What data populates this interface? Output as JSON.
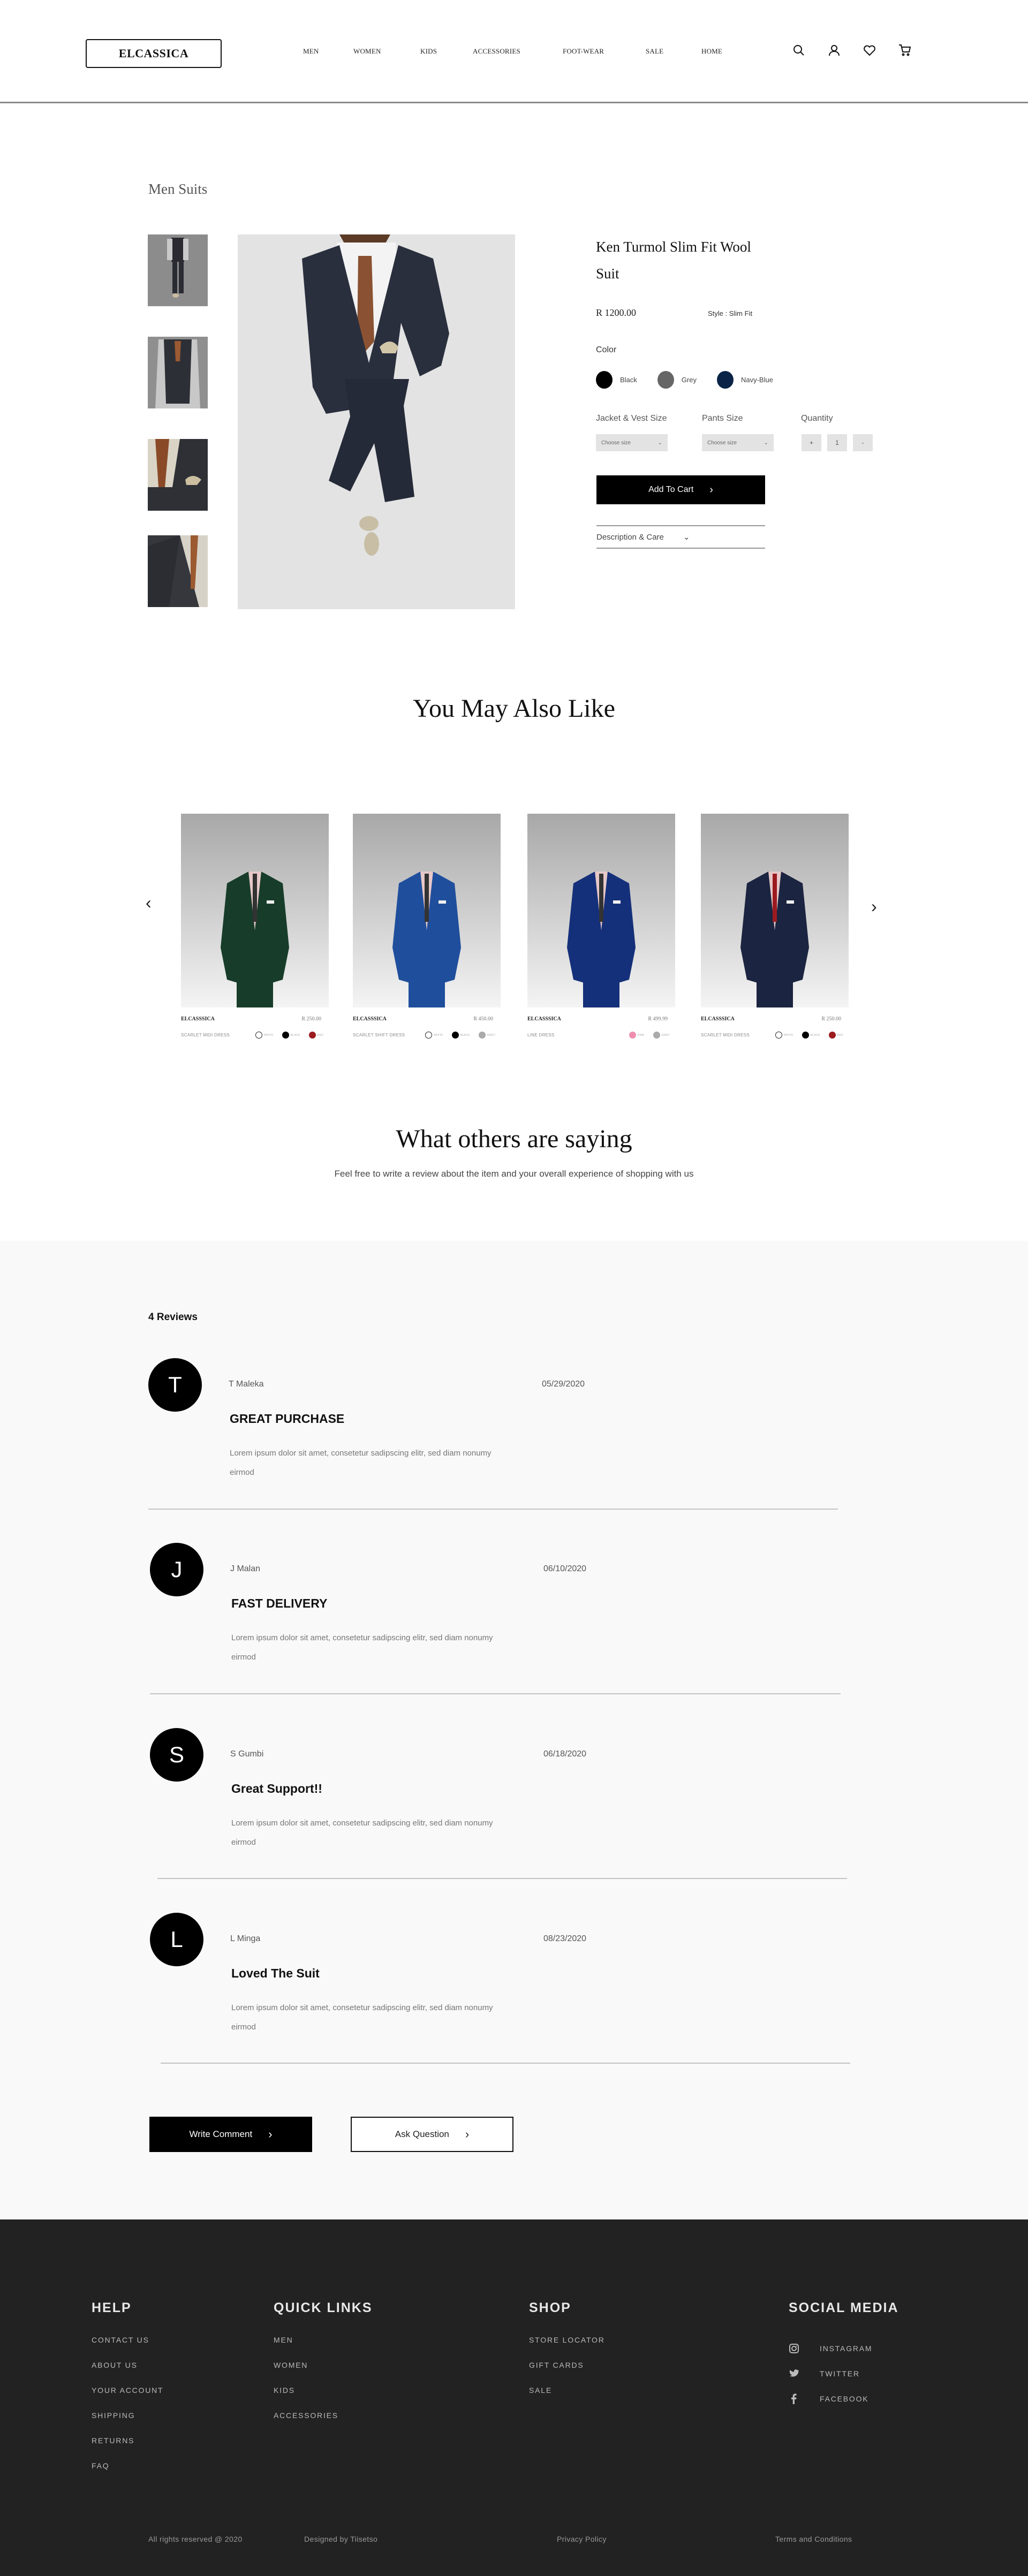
{
  "header": {
    "logo": "ELCASSICA",
    "nav": [
      "MEN",
      "WOMEN",
      "KIDS",
      "ACCESSORIES",
      "FOOT-WEAR",
      "SALE",
      "HOME"
    ],
    "icons": [
      "search-icon",
      "user-icon",
      "heart-icon",
      "cart-icon"
    ]
  },
  "product": {
    "breadcrumb": "Men Suits",
    "title": "Ken Turmol Slim Fit Wool Suit",
    "price": "R 1200.00",
    "style": "Style : Slim Fit",
    "color_label": "Color",
    "colors": [
      {
        "name": "Black",
        "hex": "#000000"
      },
      {
        "name": "Grey",
        "hex": "#666666"
      },
      {
        "name": "Navy-Blue",
        "hex": "#0a2347"
      }
    ],
    "jacket_label": "Jacket & Vest Size",
    "pants_label": "Pants Size",
    "quantity_label": "Quantity",
    "jacket_select": "Choose size",
    "pants_select": "Choose size",
    "qty_plus": "+",
    "qty_value": "1",
    "qty_minus": "-",
    "add_to_cart": "Add To Cart",
    "description": "Description & Care",
    "thumbnails": [
      "thumbnail-full-suit",
      "thumbnail-vest",
      "thumbnail-tie-detail",
      "thumbnail-lapel"
    ]
  },
  "related": {
    "title": "You May Also Like",
    "items": [
      {
        "brand": "ELCASSSICA",
        "price": "R 250.00",
        "name": "SCARLET MIDI DRESS",
        "suit_color": "#173d2a",
        "colors": [
          {
            "name": "WHITE",
            "hex": "#ffffff"
          },
          {
            "name": "BLACK",
            "hex": "#000000"
          },
          {
            "name": "RED",
            "hex": "#9b1b20"
          }
        ]
      },
      {
        "brand": "ELCASSSICA",
        "price": "R 450.00",
        "name": "SCARLET SHIFT DRESS",
        "suit_color": "#1f4e9c",
        "colors": [
          {
            "name": "WHITE",
            "hex": "#ffffff"
          },
          {
            "name": "BLACK",
            "hex": "#000000"
          },
          {
            "name": "GREY",
            "hex": "#aaaaaa"
          }
        ]
      },
      {
        "brand": "ELCASSSICA",
        "price": "R 499.99",
        "name": "LINE DRESS",
        "suit_color": "#15307a",
        "colors": [
          {
            "name": "PINK",
            "hex": "#ef8fb0"
          },
          {
            "name": "GREY",
            "hex": "#aaaaaa"
          }
        ]
      },
      {
        "brand": "ELCASSSICA",
        "price": "R 250.00",
        "name": "SCARLET MIDI DRESS",
        "suit_color": "#1b2440",
        "colors": [
          {
            "name": "WHITE",
            "hex": "#ffffff"
          },
          {
            "name": "BLACK",
            "hex": "#000000"
          },
          {
            "name": "RED",
            "hex": "#9b1b20"
          }
        ]
      }
    ]
  },
  "reviews": {
    "title": "What others are saying",
    "subtitle": "Feel free to write a review about the item and your overall experience of shopping with us",
    "count": "4 Reviews",
    "items": [
      {
        "initial": "T",
        "name": "T Maleka",
        "date": "05/29/2020",
        "title": "GREAT PURCHASE",
        "body": "Lorem ipsum dolor sit amet, consetetur sadipscing elitr, sed diam nonumy eirmod"
      },
      {
        "initial": "J",
        "name": "J Malan",
        "date": "06/10/2020",
        "title": "FAST DELIVERY",
        "body": "Lorem ipsum dolor sit amet, consetetur sadipscing elitr, sed diam nonumy eirmod"
      },
      {
        "initial": "S",
        "name": "S Gumbi",
        "date": "06/18/2020",
        "title": "Great Support!!",
        "body": "Lorem ipsum dolor sit amet, consetetur sadipscing elitr, sed diam nonumy eirmod"
      },
      {
        "initial": "L",
        "name": "L Minga",
        "date": "08/23/2020",
        "title": "Loved The Suit",
        "body": "Lorem ipsum dolor sit amet, consetetur sadipscing elitr, sed diam nonumy eirmod"
      }
    ],
    "write_comment": "Write Comment",
    "ask_question": "Ask Question"
  },
  "footer": {
    "help": {
      "title": "HELP",
      "links": [
        "CONTACT US",
        "ABOUT US",
        "YOUR ACCOUNT",
        "SHIPPING",
        "RETURNS",
        "FAQ"
      ]
    },
    "quick": {
      "title": "QUICK LINKS",
      "links": [
        "MEN",
        "WOMEN",
        "KIDS",
        "ACCESSORIES"
      ]
    },
    "shop": {
      "title": "SHOP",
      "links": [
        "STORE LOCATOR",
        "GIFT CARDS",
        "SALE"
      ]
    },
    "social": {
      "title": "SOCIAL MEDIA",
      "links": [
        "INSTAGRAM",
        "TWITTER",
        "FACEBOOK"
      ]
    },
    "rights": "All rights reserved @ 2020",
    "designed": "Designed by Tiisetso",
    "privacy": "Privacy Policy",
    "terms": "Terms and Conditions"
  }
}
